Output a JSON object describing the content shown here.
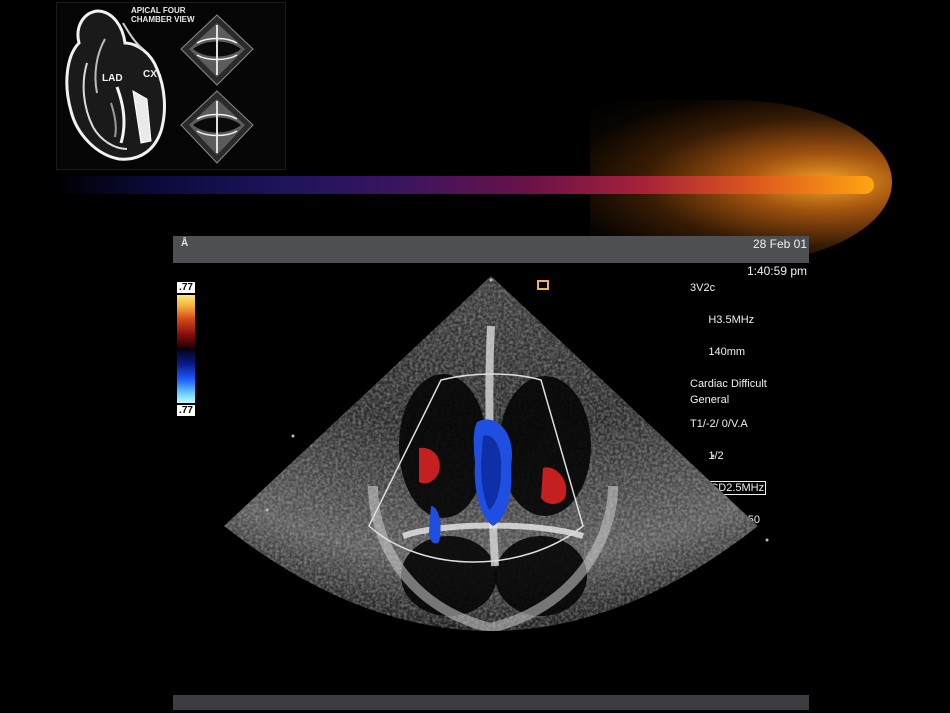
{
  "diagram": {
    "title": "APICAL FOUR\nCHAMBER VIEW",
    "label_lad": "LAD",
    "label_cx": "CX"
  },
  "ultrasound": {
    "probe_mark": "Å",
    "date": "28 Feb 01",
    "time": "1:40:59 pm",
    "transducer": "3V2c",
    "frequency": "H3.5MHz",
    "depth": "140mm",
    "preset_1": "Cardiac Difficult",
    "preset_2": "General",
    "settings_line": "T1/-2/ 0/V.A",
    "ratio": "1/2",
    "cd_freq": "CD2.5MHz",
    "cd_gain": "CD Gain =  50",
    "scale_top": ".77",
    "scale_bottom": ".77"
  },
  "colors": {
    "background": "#000000",
    "doppler_red": "#c42020",
    "doppler_blue": "#1e4fe0",
    "focus_marker": "#f0b44a",
    "beam_end": "#ffa512"
  }
}
